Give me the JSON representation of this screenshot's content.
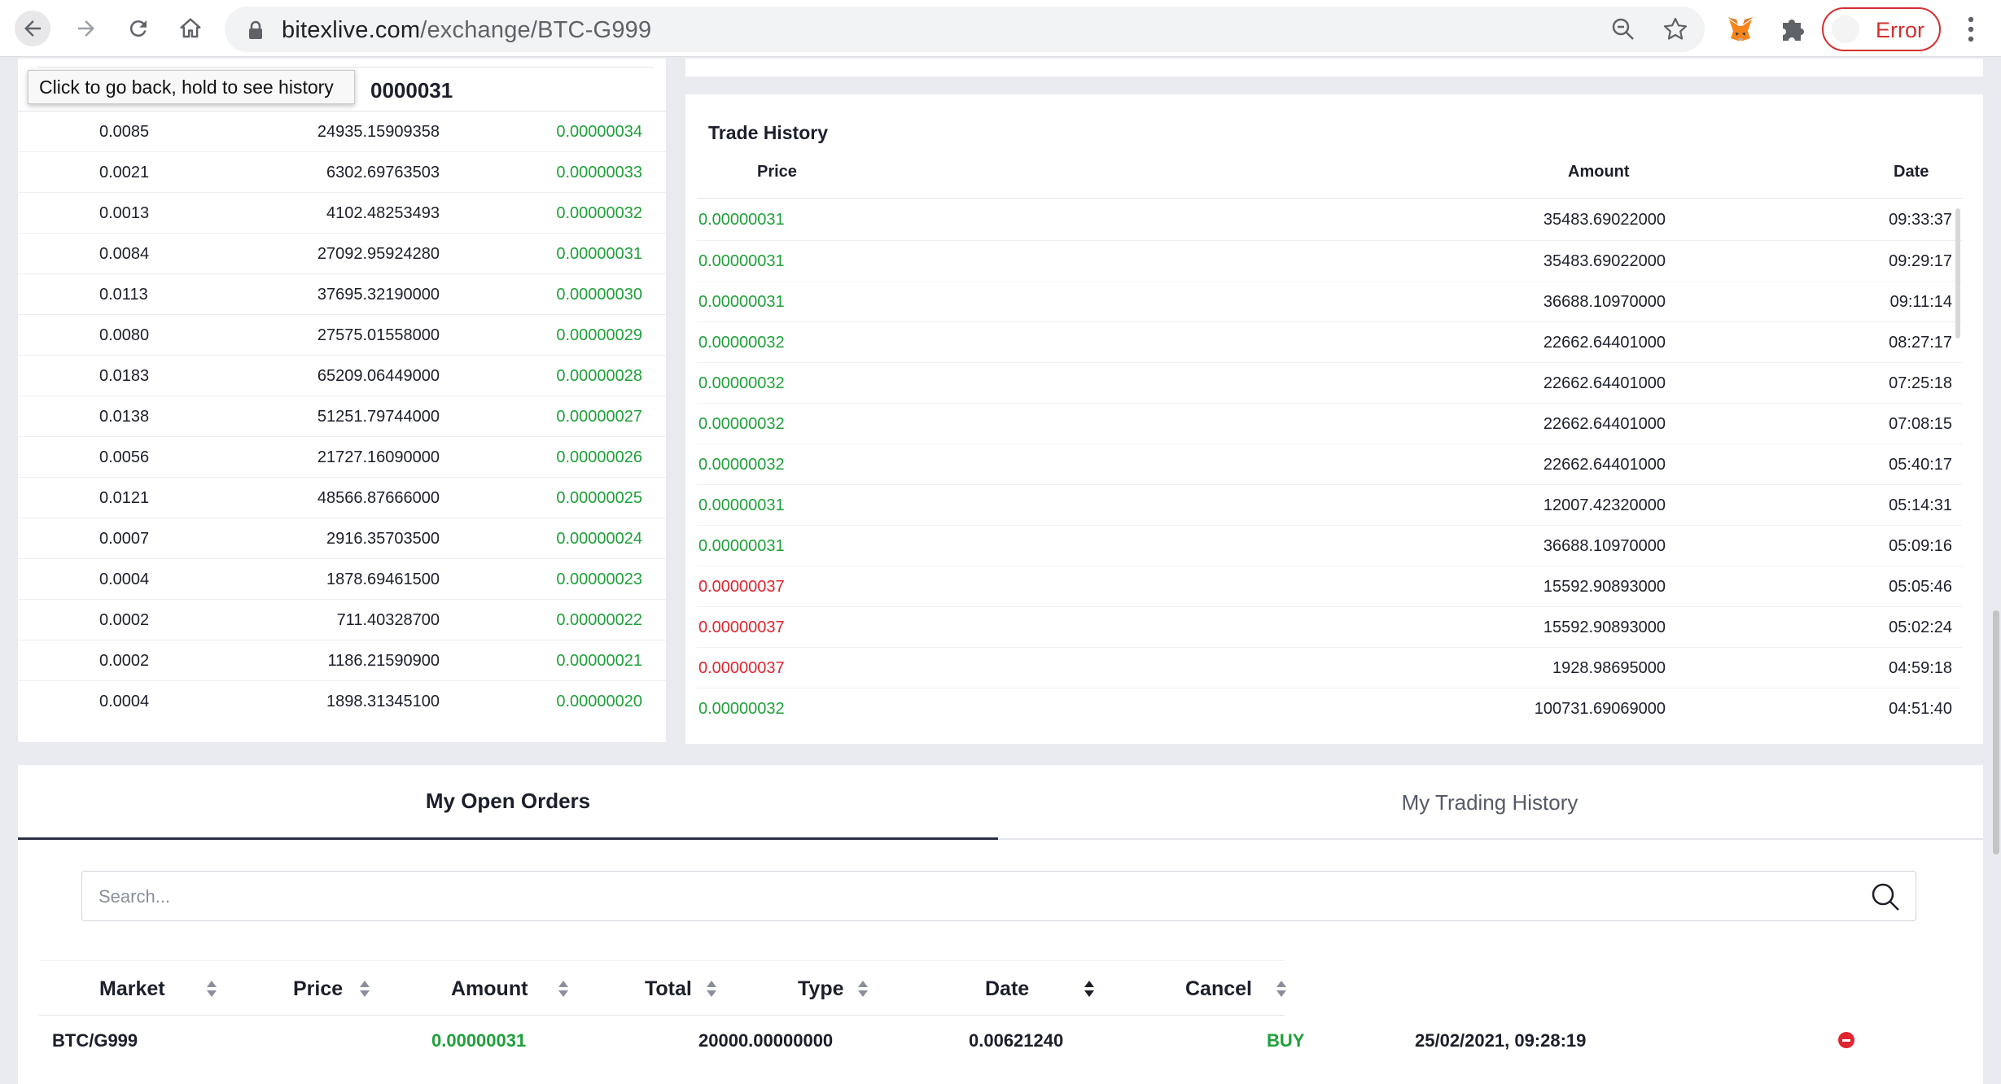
{
  "browser": {
    "url_host": "bitexlive.com",
    "url_path": "/exchange/BTC-G999",
    "error_label": "Error",
    "tooltip": "Click to go back, hold to see history"
  },
  "orderbook": {
    "header_value": "0000031",
    "rows": [
      {
        "total": "0.0085",
        "amount": "24935.15909358",
        "price": "0.00000034"
      },
      {
        "total": "0.0021",
        "amount": "6302.69763503",
        "price": "0.00000033"
      },
      {
        "total": "0.0013",
        "amount": "4102.48253493",
        "price": "0.00000032"
      },
      {
        "total": "0.0084",
        "amount": "27092.95924280",
        "price": "0.00000031"
      },
      {
        "total": "0.0113",
        "amount": "37695.32190000",
        "price": "0.00000030"
      },
      {
        "total": "0.0080",
        "amount": "27575.01558000",
        "price": "0.00000029"
      },
      {
        "total": "0.0183",
        "amount": "65209.06449000",
        "price": "0.00000028"
      },
      {
        "total": "0.0138",
        "amount": "51251.79744000",
        "price": "0.00000027"
      },
      {
        "total": "0.0056",
        "amount": "21727.16090000",
        "price": "0.00000026"
      },
      {
        "total": "0.0121",
        "amount": "48566.87666000",
        "price": "0.00000025"
      },
      {
        "total": "0.0007",
        "amount": "2916.35703500",
        "price": "0.00000024"
      },
      {
        "total": "0.0004",
        "amount": "1878.69461500",
        "price": "0.00000023"
      },
      {
        "total": "0.0002",
        "amount": "711.40328700",
        "price": "0.00000022"
      },
      {
        "total": "0.0002",
        "amount": "1186.21590900",
        "price": "0.00000021"
      },
      {
        "total": "0.0004",
        "amount": "1898.31345100",
        "price": "0.00000020"
      }
    ]
  },
  "trade_history": {
    "title": "Trade History",
    "headers": {
      "price": "Price",
      "amount": "Amount",
      "date": "Date"
    },
    "rows": [
      {
        "price": "0.00000031",
        "side": "buy",
        "amount": "35483.69022000",
        "date": "09:33:37"
      },
      {
        "price": "0.00000031",
        "side": "buy",
        "amount": "35483.69022000",
        "date": "09:29:17"
      },
      {
        "price": "0.00000031",
        "side": "buy",
        "amount": "36688.10970000",
        "date": "09:11:14"
      },
      {
        "price": "0.00000032",
        "side": "buy",
        "amount": "22662.64401000",
        "date": "08:27:17"
      },
      {
        "price": "0.00000032",
        "side": "buy",
        "amount": "22662.64401000",
        "date": "07:25:18"
      },
      {
        "price": "0.00000032",
        "side": "buy",
        "amount": "22662.64401000",
        "date": "07:08:15"
      },
      {
        "price": "0.00000032",
        "side": "buy",
        "amount": "22662.64401000",
        "date": "05:40:17"
      },
      {
        "price": "0.00000031",
        "side": "buy",
        "amount": "12007.42320000",
        "date": "05:14:31"
      },
      {
        "price": "0.00000031",
        "side": "buy",
        "amount": "36688.10970000",
        "date": "05:09:16"
      },
      {
        "price": "0.00000037",
        "side": "sell",
        "amount": "15592.90893000",
        "date": "05:05:46"
      },
      {
        "price": "0.00000037",
        "side": "sell",
        "amount": "15592.90893000",
        "date": "05:02:24"
      },
      {
        "price": "0.00000037",
        "side": "sell",
        "amount": "1928.98695000",
        "date": "04:59:18"
      },
      {
        "price": "0.00000032",
        "side": "buy",
        "amount": "100731.69069000",
        "date": "04:51:40"
      }
    ]
  },
  "orders": {
    "tabs": {
      "open": "My Open Orders",
      "history": "My Trading History"
    },
    "search_placeholder": "Search...",
    "headers": {
      "market": "Market",
      "price": "Price",
      "amount": "Amount",
      "total": "Total",
      "type": "Type",
      "date": "Date",
      "cancel": "Cancel"
    },
    "row": {
      "market": "BTC/G999",
      "price": "0.00000031",
      "amount": "20000.00000000",
      "total": "0.00621240",
      "type": "BUY",
      "date": "25/02/2021, 09:28:19"
    }
  },
  "colors": {
    "buy": "#1fa03a",
    "sell": "#e0252f",
    "accent": "#2b3046"
  }
}
